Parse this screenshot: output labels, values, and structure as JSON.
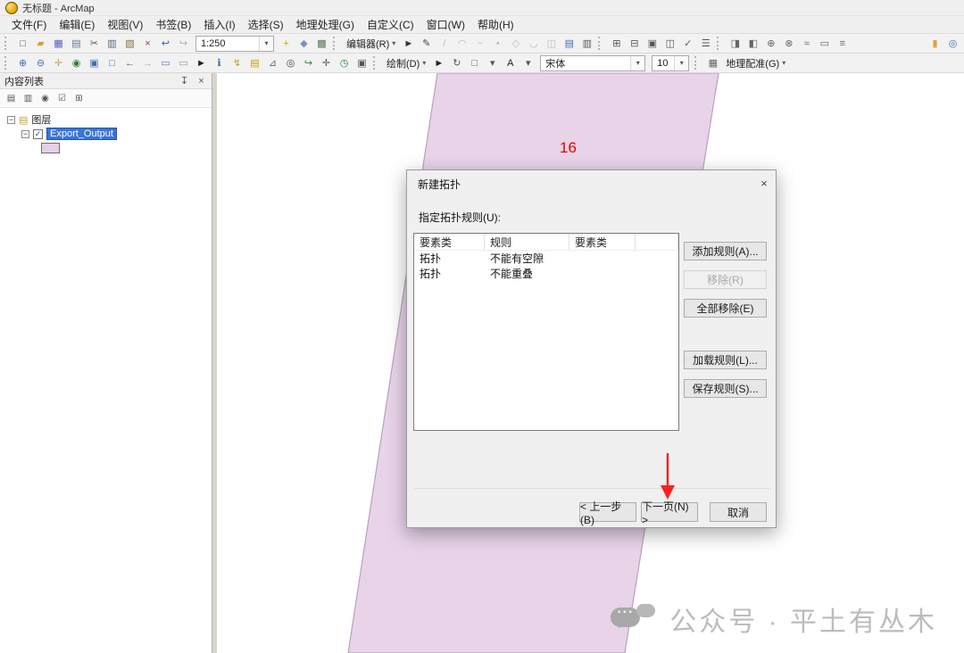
{
  "window": {
    "title": "无标题 - ArcMap"
  },
  "menu": {
    "items": [
      {
        "name": "menu-file",
        "label": "文件(F)"
      },
      {
        "name": "menu-edit",
        "label": "编辑(E)"
      },
      {
        "name": "menu-view",
        "label": "视图(V)"
      },
      {
        "name": "menu-bookmarks",
        "label": "书签(B)"
      },
      {
        "name": "menu-insert",
        "label": "插入(I)"
      },
      {
        "name": "menu-selection",
        "label": "选择(S)"
      },
      {
        "name": "menu-geoprocessing",
        "label": "地理处理(G)"
      },
      {
        "name": "menu-customize",
        "label": "自定义(C)"
      },
      {
        "name": "menu-window",
        "label": "窗口(W)"
      },
      {
        "name": "menu-help",
        "label": "帮助(H)"
      }
    ]
  },
  "toolbar1": {
    "std": [
      {
        "name": "new-document-icon",
        "glyph": "□",
        "color": "#555555"
      },
      {
        "name": "open-folder-icon",
        "glyph": "▰",
        "color": "#d9a33a"
      },
      {
        "name": "save-icon",
        "glyph": "▦",
        "color": "#5560c0"
      },
      {
        "name": "print-icon",
        "glyph": "▤",
        "color": "#667788"
      },
      {
        "name": "cut-icon",
        "glyph": "✂",
        "color": "#555555"
      },
      {
        "name": "copy-icon",
        "glyph": "▥",
        "color": "#556677"
      },
      {
        "name": "paste-icon",
        "glyph": "▧",
        "color": "#8a6d3b"
      },
      {
        "name": "delete-icon",
        "glyph": "×",
        "color": "#c03030"
      },
      {
        "name": "undo-icon",
        "glyph": "↩",
        "color": "#2a5db0"
      },
      {
        "name": "redo-icon",
        "glyph": "↪",
        "color": "#aab2bc"
      }
    ],
    "scale_value": "1:250",
    "post_scale": [
      {
        "name": "add-data-icon",
        "glyph": "+",
        "color": "#caa200"
      },
      {
        "name": "editor-tool-icon",
        "glyph": "◆",
        "color": "#7b8fd4"
      },
      {
        "name": "table-options-icon",
        "glyph": "▩",
        "color": "#557755"
      }
    ],
    "editor_label": "编辑器(R)",
    "editor_icons": [
      {
        "name": "edit-arrow-icon",
        "glyph": "►",
        "color": "#333333"
      },
      {
        "name": "sketch-pencil-icon",
        "glyph": "✎",
        "color": "#444444"
      },
      {
        "name": "straight-segment-icon",
        "glyph": "/",
        "disabled": true
      },
      {
        "name": "arc-segment-icon",
        "glyph": "◠",
        "disabled": true
      },
      {
        "name": "trace-icon",
        "glyph": "~",
        "disabled": true
      },
      {
        "name": "point-icon",
        "glyph": "•",
        "disabled": true
      },
      {
        "name": "edit-vertices-icon",
        "glyph": "◇",
        "disabled": true
      },
      {
        "name": "reshape-icon",
        "glyph": "◡",
        "disabled": true
      },
      {
        "name": "split-icon",
        "glyph": "◫",
        "disabled": true
      },
      {
        "name": "attributes-icon",
        "glyph": "▤",
        "color": "#3b6fb5"
      },
      {
        "name": "sketch-properties-icon",
        "glyph": "▥",
        "color": "#555555"
      }
    ],
    "group3": [
      {
        "name": "topology-edit-icon",
        "glyph": "⊞",
        "color": "#555555"
      },
      {
        "name": "snapping-icon",
        "glyph": "⊟",
        "color": "#555555"
      },
      {
        "name": "feature-construction-icon",
        "glyph": "▣",
        "color": "#555555"
      },
      {
        "name": "shared-features-icon",
        "glyph": "◫",
        "color": "#555555"
      },
      {
        "name": "validate-topology-icon",
        "glyph": "✓",
        "color": "#2f7d32"
      },
      {
        "name": "error-inspector-icon",
        "glyph": "☰",
        "color": "#555555"
      }
    ],
    "group4": [
      {
        "name": "map-topology-icon",
        "glyph": "◨",
        "color": "#666666"
      },
      {
        "name": "planarize-icon",
        "glyph": "◧",
        "color": "#666666"
      },
      {
        "name": "construct-polygons-icon",
        "glyph": "⊕",
        "color": "#666666"
      },
      {
        "name": "split-polygons-icon",
        "glyph": "⊗",
        "color": "#666666"
      },
      {
        "name": "generalize-icon",
        "glyph": "≈",
        "color": "#666666"
      },
      {
        "name": "align-edge-icon",
        "glyph": "▭",
        "color": "#666666"
      },
      {
        "name": "options-icon",
        "glyph": "≡",
        "color": "#666666"
      }
    ],
    "end_icons": [
      {
        "name": "catalog-window-icon",
        "glyph": "▮",
        "color": "#d9a33a"
      },
      {
        "name": "search-window-icon",
        "glyph": "◎",
        "color": "#3b6fb5"
      }
    ]
  },
  "toolbar2": {
    "tools": [
      {
        "name": "zoom-in-icon",
        "glyph": "⊕",
        "color": "#3b6fb5"
      },
      {
        "name": "zoom-out-icon",
        "glyph": "⊖",
        "color": "#3b6fb5"
      },
      {
        "name": "pan-icon",
        "glyph": "✛",
        "color": "#caa23a"
      },
      {
        "name": "full-extent-icon",
        "glyph": "◉",
        "color": "#2e7d32"
      },
      {
        "name": "fixed-zoom-in-icon",
        "glyph": "▣",
        "color": "#3b6fb5"
      },
      {
        "name": "fixed-zoom-out-icon",
        "glyph": "□",
        "color": "#3b6fb5"
      },
      {
        "name": "back-extent-icon",
        "glyph": "←",
        "color": "#2a5db0"
      },
      {
        "name": "forward-extent-icon",
        "glyph": "→",
        "color": "#9fb0c8"
      },
      {
        "name": "select-by-rectangle-icon",
        "glyph": "▭",
        "color": "#5a7fb5"
      },
      {
        "name": "clear-selection-icon",
        "glyph": "▭",
        "color": "#999999"
      },
      {
        "name": "select-elements-icon",
        "glyph": "►",
        "color": "#222222"
      },
      {
        "name": "identify-icon",
        "glyph": "ℹ",
        "color": "#2a5db0"
      },
      {
        "name": "hyperlink-icon",
        "glyph": "↯",
        "color": "#caa200"
      },
      {
        "name": "html-popup-icon",
        "glyph": "▤",
        "color": "#caa200"
      },
      {
        "name": "measure-icon",
        "glyph": "⊿",
        "color": "#556677"
      },
      {
        "name": "find-icon",
        "glyph": "◎",
        "color": "#444444"
      },
      {
        "name": "find-route-icon",
        "glyph": "↪",
        "color": "#2f7d32"
      },
      {
        "name": "go-to-xy-icon",
        "glyph": "✛",
        "color": "#555555"
      },
      {
        "name": "time-slider-icon",
        "glyph": "◷",
        "color": "#2f7d32"
      },
      {
        "name": "viewer-window-icon",
        "glyph": "▣",
        "color": "#555555"
      }
    ],
    "draw_label": "绘制(D)",
    "draw_icons": [
      {
        "name": "draw-select-icon",
        "glyph": "►",
        "color": "#222222"
      },
      {
        "name": "rotate-icon",
        "glyph": "↻",
        "color": "#555555"
      },
      {
        "name": "shape-tool-icon",
        "glyph": "□",
        "color": "#555555"
      },
      {
        "name": "shape-dropdown-arrow-icon",
        "glyph": "▾",
        "color": "#555555"
      },
      {
        "name": "text-tool-icon",
        "glyph": "A",
        "color": "#222222"
      },
      {
        "name": "text-dropdown-arrow-icon",
        "glyph": "▾",
        "color": "#555555"
      }
    ],
    "font_family": "宋体",
    "font_size": "10",
    "georef_icons": [
      {
        "name": "georef-layer-icon",
        "glyph": "▦",
        "color": "#666666"
      }
    ],
    "georef_label": "地理配准(G)"
  },
  "toc": {
    "title": "内容列表",
    "close_glyph": "×",
    "toolbar": [
      {
        "name": "list-by-drawing-order-icon",
        "glyph": "▤",
        "color": "#555555"
      },
      {
        "name": "list-by-source-icon",
        "glyph": "▥",
        "color": "#555555"
      },
      {
        "name": "list-by-visibility-icon",
        "glyph": "◉",
        "color": "#555555"
      },
      {
        "name": "list-by-selection-icon",
        "glyph": "☑",
        "color": "#555555"
      },
      {
        "name": "toc-options-icon",
        "glyph": "⊞",
        "color": "#555555"
      }
    ],
    "expander_glyph": "−",
    "root_label": "图层",
    "layer": {
      "name": "Export_Output",
      "checked": true,
      "checkmark": "✓"
    },
    "selection_color": "#3875d7",
    "swatch_color": "#e7cfe7"
  },
  "map": {
    "feature_label": "16",
    "label_color": "#e60000",
    "polygon_fill": "#e8d3e9",
    "polygon_stroke": "#b9a2ba"
  },
  "dialog": {
    "title": "新建拓扑",
    "close_glyph": "×",
    "prompt": "指定拓扑规则(U):",
    "table": {
      "headers": [
        "要素类",
        "规则",
        "要素类"
      ],
      "rows": [
        [
          "拓扑",
          "不能有空隙",
          ""
        ],
        [
          "拓扑",
          "不能重叠",
          ""
        ]
      ]
    },
    "buttons": {
      "add": "添加规则(A)...",
      "remove": "移除(R)",
      "remove_all": "全部移除(E)",
      "load": "加载规则(L)...",
      "save": "保存规则(S)...",
      "back": "< 上一步(B)",
      "next": "下一页(N) >",
      "cancel": "取消"
    }
  },
  "annotation": {
    "arrow_color": "#ff1f1f"
  },
  "watermark": {
    "text": "公众号 · 平土有丛木"
  }
}
